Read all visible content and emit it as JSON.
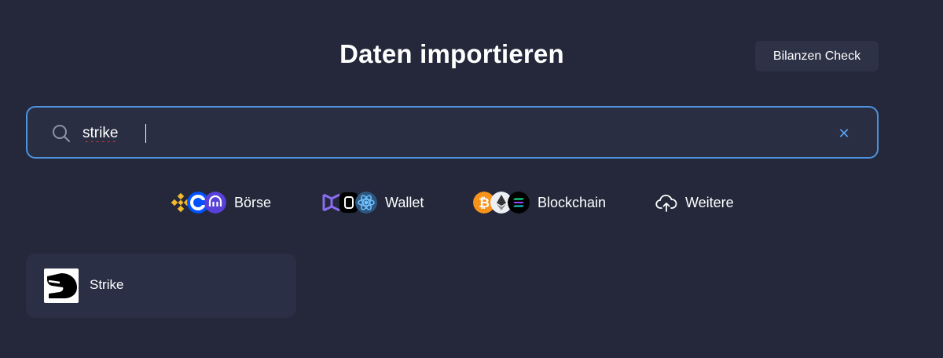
{
  "header": {
    "title": "Daten importieren",
    "balance_check_label": "Bilanzen Check"
  },
  "search": {
    "value": "strike",
    "placeholder": "",
    "icon": "search-icon",
    "clear_icon": "close-icon",
    "accent_color": "#4f93e0"
  },
  "categories": [
    {
      "label": "Börse",
      "icons": [
        "binance-icon",
        "coinbase-icon",
        "kraken-icon"
      ]
    },
    {
      "label": "Wallet",
      "icons": [
        "exodus-icon",
        "ledger-icon",
        "electrum-icon"
      ]
    },
    {
      "label": "Blockchain",
      "icons": [
        "bitcoin-icon",
        "ethereum-icon",
        "solana-icon"
      ]
    },
    {
      "label": "Weitere",
      "icons": [
        "cloud-upload-icon"
      ]
    }
  ],
  "results": [
    {
      "name": "Strike",
      "icon": "strike-logo-icon"
    }
  ]
}
